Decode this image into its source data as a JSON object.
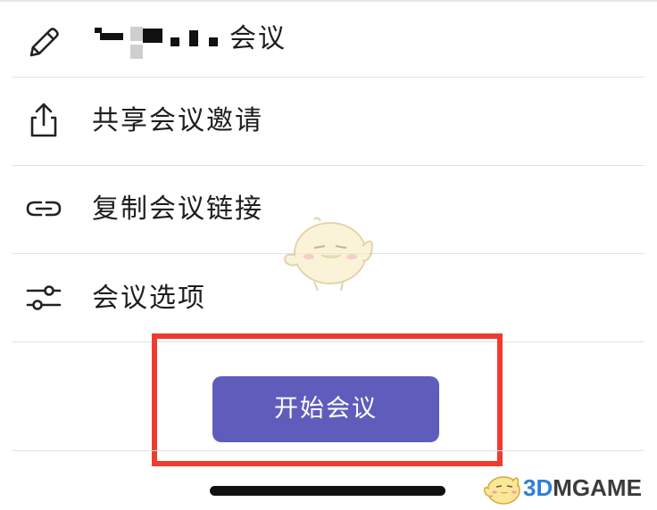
{
  "menu": {
    "items": [
      {
        "icon": "pencil-icon",
        "label": "会议",
        "label_prefix_redacted": true
      },
      {
        "icon": "share-icon",
        "label": "共享会议邀请"
      },
      {
        "icon": "link-icon",
        "label": "复制会议链接"
      },
      {
        "icon": "sliders-icon",
        "label": "会议选项"
      }
    ]
  },
  "actions": {
    "start_label": "开始会议"
  },
  "colors": {
    "primary_button": "#5f5cbc",
    "highlight_box": "#f03b2f",
    "divider": "#e2e2e2"
  },
  "watermark": {
    "brand_3d": "3D",
    "brand_rest": "MGAME"
  }
}
